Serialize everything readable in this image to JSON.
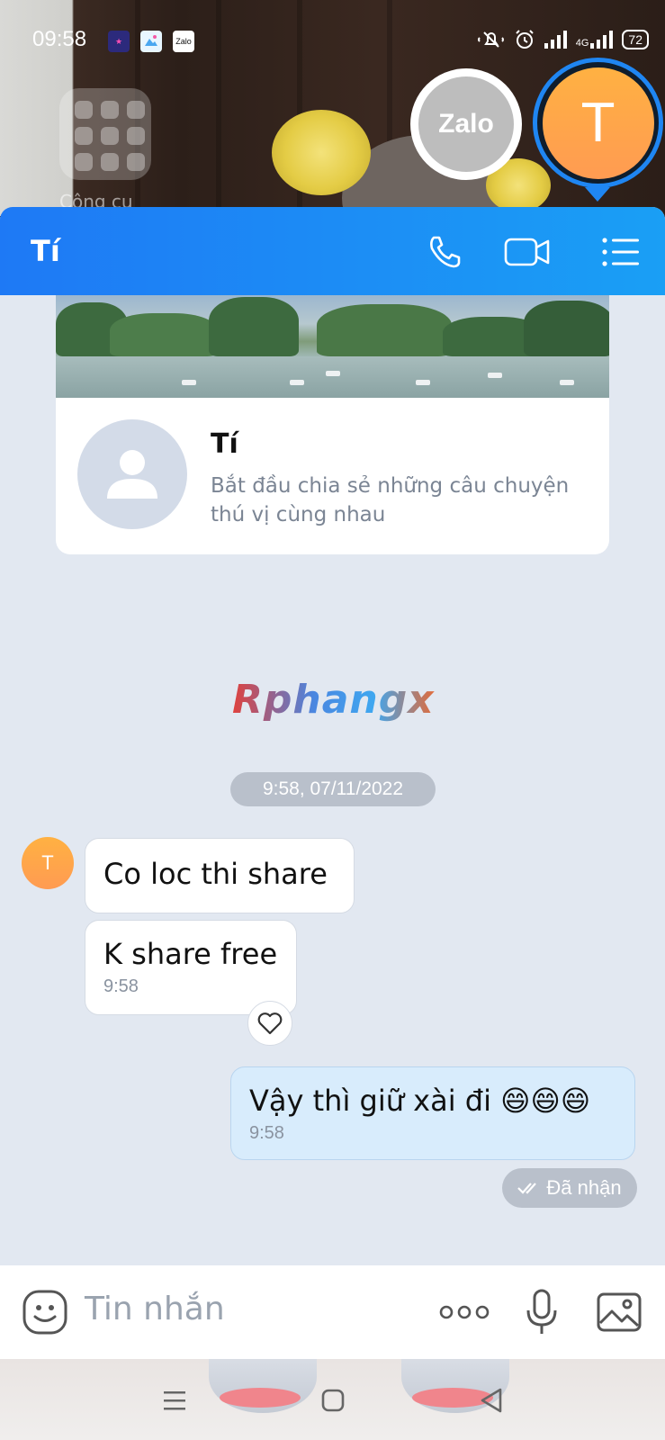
{
  "status_bar": {
    "time": "09:58",
    "notification_icons": [
      "star-app-icon",
      "gallery-app-icon",
      "zalo-notification-icon"
    ],
    "zalo_badge": "Zalo",
    "network": "4G",
    "battery": "72"
  },
  "home_screen": {
    "folder_label": "Công cụ"
  },
  "chat_heads": {
    "zalo_label": "Zalo",
    "contact_initial": "T"
  },
  "chat": {
    "title": "Tí",
    "header_icons": [
      "phone-icon",
      "video-call-icon",
      "menu-list-icon"
    ],
    "profile": {
      "name": "Tí",
      "description": "Bắt đầu chia sẻ những câu chuyện thú vị cùng nhau"
    },
    "watermark": "Rphangx",
    "date_separator": "9:58, 07/11/2022",
    "sender_initial": "T",
    "messages": [
      {
        "from": "contact",
        "text": "Co loc thi share",
        "time": ""
      },
      {
        "from": "contact",
        "text": "K share free",
        "time": "9:58"
      },
      {
        "from": "me",
        "text": "Vậy thì giữ xài đi 😄😄😄",
        "time": "9:58"
      }
    ],
    "receipt": "Đã nhận"
  },
  "composer": {
    "placeholder": "Tin nhắn"
  },
  "colors": {
    "header_start": "#1e79f5",
    "header_end": "#1a9ff5",
    "chat_bg": "#e2e8f1",
    "my_bubble": "#d8ecfc",
    "avatar_orange": "#ffa84a"
  }
}
